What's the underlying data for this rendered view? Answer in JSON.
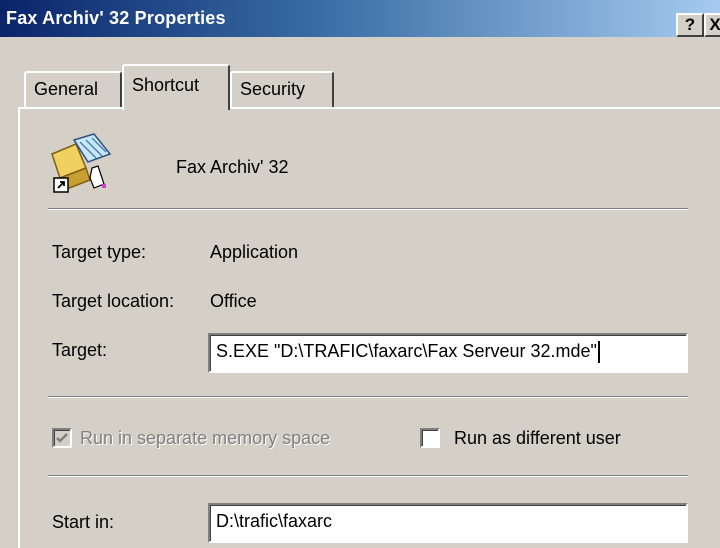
{
  "window": {
    "title": "Fax Archiv' 32 Properties",
    "help_button": "?",
    "close_button": "X"
  },
  "tabs": [
    {
      "label": "General",
      "active": false
    },
    {
      "label": "Shortcut",
      "active": true
    },
    {
      "label": "Security",
      "active": false
    }
  ],
  "shortcut": {
    "name": "Fax Archiv' 32",
    "target_type_label": "Target type:",
    "target_type_value": "Application",
    "target_location_label": "Target location:",
    "target_location_value": "Office",
    "target_label": "Target:",
    "target_value": "S.EXE \"D:\\TRAFIC\\faxarc\\Fax Serveur 32.mde\"",
    "run_separate_label": "Run in separate memory space",
    "run_separate_checked": true,
    "run_separate_enabled": false,
    "run_as_label": "Run as different user",
    "run_as_checked": false,
    "start_in_label": "Start in:",
    "start_in_value": "D:\\trafic\\faxarc"
  },
  "icons": {
    "app": "shortcut-app-icon",
    "help": "help-icon",
    "close": "close-icon"
  }
}
